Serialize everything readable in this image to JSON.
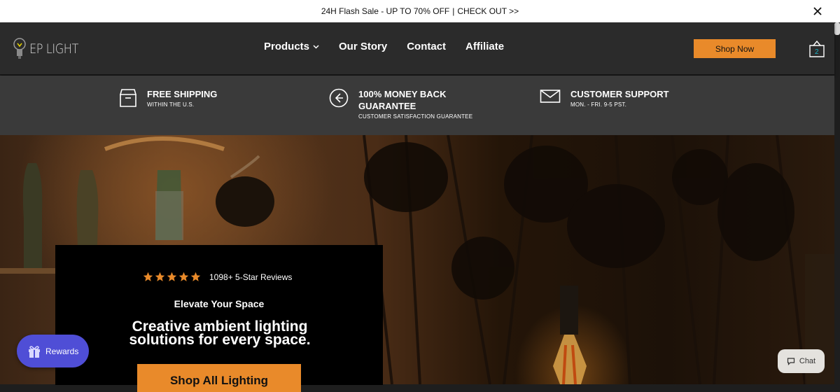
{
  "announcement": {
    "sale": "24H Flash Sale - UP TO 70% OFF",
    "separator": "|",
    "cta": "CHECK OUT >>"
  },
  "header": {
    "logo_text": "EP LIGHT",
    "nav": [
      {
        "label": "Products",
        "has_dropdown": true
      },
      {
        "label": "Our Story"
      },
      {
        "label": "Contact"
      },
      {
        "label": "Affiliate"
      }
    ],
    "shop_now": "Shop Now",
    "cart_count": "2"
  },
  "features": [
    {
      "title": "FREE SHIPPING",
      "sub": "WITHIN THE U.S.",
      "icon": "box-icon"
    },
    {
      "title": "100% MONEY BACK GUARANTEE",
      "sub": "CUSTOMER SATISFACTION GUARANTEE",
      "icon": "arrow-left-circle-icon"
    },
    {
      "title": "CUSTOMER SUPPORT",
      "sub": "MON. - FRI. 9-5 PST.",
      "icon": "mail-icon"
    }
  ],
  "hero": {
    "rating_stars": 5,
    "rating_text": "1098+ 5-Star Reviews",
    "kicker": "Elevate Your Space",
    "headline": "Creative ambient lighting solutions for every space.",
    "cta": "Shop All Lighting"
  },
  "widgets": {
    "rewards": "Rewards",
    "chat": "Chat"
  },
  "colors": {
    "accent": "#e98a2a",
    "header_bg": "#2b2b2b",
    "features_bg": "#3a3a3a",
    "rewards_bg": "#4f4ed6"
  }
}
